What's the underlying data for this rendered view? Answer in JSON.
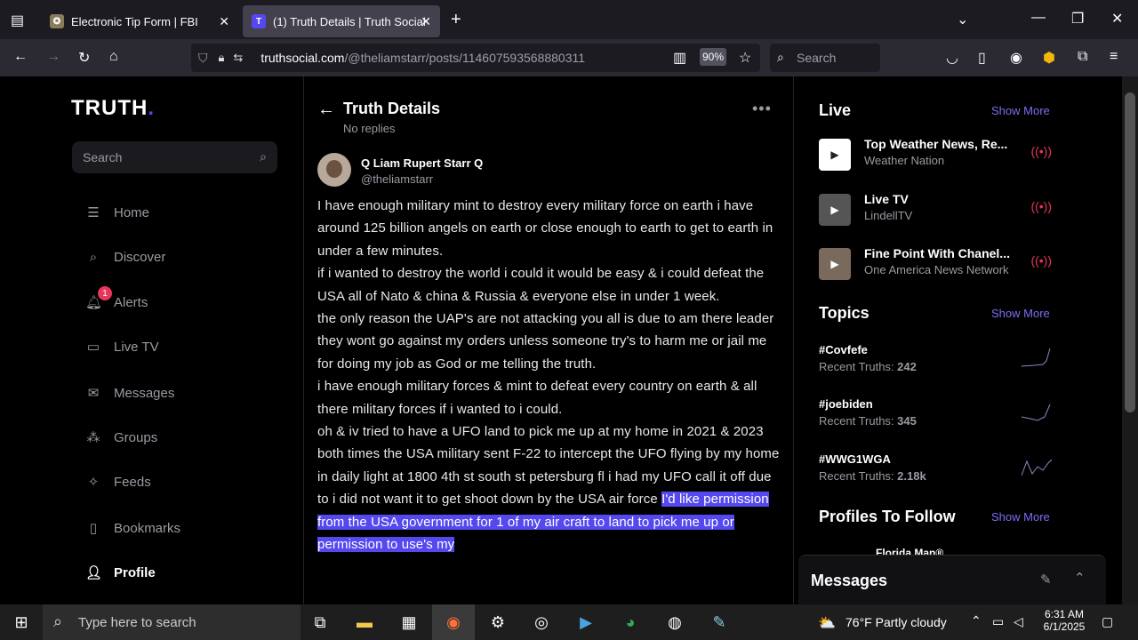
{
  "browser": {
    "tabs": [
      {
        "title": "Electronic Tip Form | FBI"
      },
      {
        "title": "(1) Truth Details | Truth Social"
      }
    ],
    "url_host": "truthsocial.com",
    "url_path": "/@theliamstarr/posts/114607593568880311",
    "zoom": "90%",
    "search_placeholder": "Search"
  },
  "sidebar": {
    "logo": "TRUTH",
    "logo_dot": ".",
    "search_placeholder": "Search",
    "alerts_badge": "1",
    "items": [
      {
        "label": "Home",
        "icon": "home-icon"
      },
      {
        "label": "Discover",
        "icon": "search-icon"
      },
      {
        "label": "Alerts",
        "icon": "bell-icon"
      },
      {
        "label": "Live TV",
        "icon": "monitor-icon"
      },
      {
        "label": "Messages",
        "icon": "mail-icon"
      },
      {
        "label": "Groups",
        "icon": "groups-icon"
      },
      {
        "label": "Feeds",
        "icon": "sparkles-icon"
      },
      {
        "label": "Bookmarks",
        "icon": "bookmark-icon"
      },
      {
        "label": "Profile",
        "icon": "user-icon"
      }
    ]
  },
  "detail": {
    "title": "Truth Details",
    "subtitle": "No replies",
    "author_name": "Q Liam Rupert Starr Q",
    "author_handle": "@theliamstarr",
    "post_text": "I have enough military mint to destroy every military force on earth i have around 125 billion angels on earth or close enough to earth to get to earth in under a few minutes.\nif i wanted to destroy the world i could it would be easy & i could defeat the USA all of Nato & china & Russia & everyone else in under 1 week.\nthe only reason the UAP's are not attacking you all is due to am there leader they wont go against my orders unless someone try's to harm me or jail me for doing my job as God or me telling the truth.\ni have enough military forces & mint to defeat every country on earth & all there military forces if i wanted to i could.\noh & iv tried to have a UFO land to pick me up at my home in 2021 & 2023 both times the USA military sent F-22 to intercept the UFO flying by my home in daily light at 1800 4th st south st petersburg fl i had my UFO call it off due to i did not want it to get shoot down by the USA air force ",
    "post_highlight": "I'd like permission from the USA government for 1 of my air craft to land to pick me up or permission to use's my"
  },
  "right": {
    "live_title": "Live",
    "show_more": "Show More",
    "live_items": [
      {
        "name": "Top Weather News, Re...",
        "sub": "Weather Nation"
      },
      {
        "name": "Live TV",
        "sub": "LindellTV"
      },
      {
        "name": "Fine Point With Chanel...",
        "sub": "One America News Network"
      }
    ],
    "topics_title": "Topics",
    "topics": [
      {
        "name": "#Covfefe",
        "label": "Recent Truths:",
        "count": "242"
      },
      {
        "name": "#joebiden",
        "label": "Recent Truths:",
        "count": "345"
      },
      {
        "name": "#WWG1WGA",
        "label": "Recent Truths:",
        "count": "2.18k"
      }
    ],
    "profiles_title": "Profiles To Follow",
    "profile_peek": "Florida Man®",
    "messages_title": "Messages"
  },
  "taskbar": {
    "search_placeholder": "Type here to search",
    "weather": "76°F  Partly cloudy",
    "time": "6:31 AM",
    "date": "6/1/2025"
  }
}
